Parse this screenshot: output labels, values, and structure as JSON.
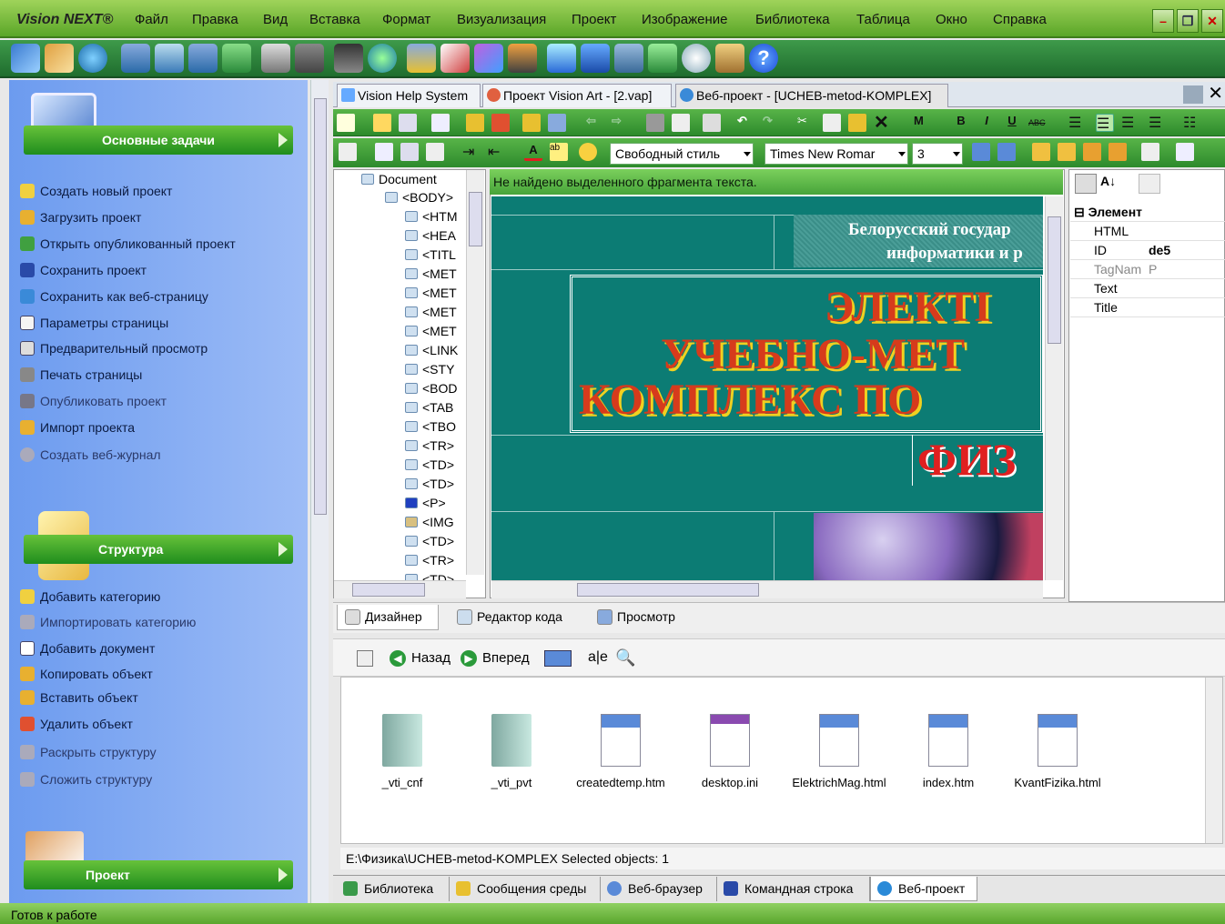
{
  "app": {
    "brand": "Vision NEXT®"
  },
  "menu": [
    "Файл",
    "Правка",
    "Вид",
    "Вставка",
    "Формат",
    "Визуализация",
    "Проект",
    "Изображение",
    "Библиотека",
    "Таблица",
    "Окно",
    "Справка"
  ],
  "sidebar": {
    "main_tasks": {
      "title": "Основные задачи",
      "items": [
        "Создать новый проект",
        "Загрузить проект",
        "Открыть опубликованный проект",
        "Сохранить проект",
        "Сохранить как веб-страницу",
        "Параметры страницы",
        "Предварительный просмотр",
        "Печать страницы",
        "Опубликовать проект",
        "Импорт проекта",
        "Создать веб-журнал"
      ]
    },
    "structure": {
      "title": "Структура",
      "items": [
        "Добавить категорию",
        "Импортировать категорию",
        "Добавить документ",
        "Копировать объект",
        "Вставить объект",
        "Удалить объект",
        "Раскрыть структуру",
        "Сложить структуру"
      ]
    },
    "project": {
      "title": "Проект"
    }
  },
  "doc_tabs": [
    "Vision Help System",
    "Проект Vision Art - [2.vap]",
    "Веб-проект - [UCHEB-metod-KOMPLEX]"
  ],
  "format": {
    "style": "Свободный стиль",
    "font": "Times New Romar",
    "size": "3"
  },
  "tree": {
    "root": "Document",
    "nodes": [
      "<BODY>",
      "<HTM",
      "<HEA",
      "<TITL",
      "<MET",
      "<MET",
      "<MET",
      "<MET",
      "<LINK",
      "<STY",
      "<BOD",
      "<TAB",
      "<TBO",
      "<TR>",
      "<TD>",
      "<TD>",
      "<P>",
      "<IMG",
      "<TD>",
      "<TR>",
      "<TD>"
    ]
  },
  "message": "Не найдено выделенного фрагмента текста.",
  "canvas": {
    "header_line1": "Белорусский государ",
    "header_line2": "информатики и р",
    "title1": "ЭЛЕКТІ",
    "title2": "УЧЕБНО-МЕТ",
    "title3": "КОМПЛЕКС ПО",
    "title4": "ФИЗ"
  },
  "properties": {
    "section": "Элемент",
    "rows": [
      {
        "name": "HTML",
        "value": ""
      },
      {
        "name": "ID",
        "value": "de5"
      },
      {
        "name": "TagNam",
        "value": "P"
      },
      {
        "name": "Text",
        "value": ""
      },
      {
        "name": "Title",
        "value": ""
      }
    ]
  },
  "view_tabs": [
    "Дизайнер",
    "Редактор кода",
    "Просмотр"
  ],
  "browser": {
    "back": "Назад",
    "forward": "Вперед"
  },
  "files": [
    {
      "name": "_vti_cnf",
      "type": "folder"
    },
    {
      "name": "_vti_pvt",
      "type": "folder"
    },
    {
      "name": "createdtemp.htm",
      "type": "html"
    },
    {
      "name": "desktop.ini",
      "type": "ini"
    },
    {
      "name": "ElektrichMag.html",
      "type": "html"
    },
    {
      "name": "index.htm",
      "type": "html"
    },
    {
      "name": "KvantFizika.html",
      "type": "html"
    }
  ],
  "path_status": "E:\\Физика\\UCHEB-metod-KOMPLEX  Selected objects: 1",
  "bottom_tabs": [
    "Библиотека",
    "Сообщения среды",
    "Веб-браузер",
    "Командная строка",
    "Веб-проект"
  ],
  "status": "Готов к работе",
  "colors": {
    "green_bar": "#5aa628",
    "sidebar_blue": "#7fa8f2",
    "canvas_teal": "#0c7c74",
    "banner_red": "#d63b1c"
  }
}
